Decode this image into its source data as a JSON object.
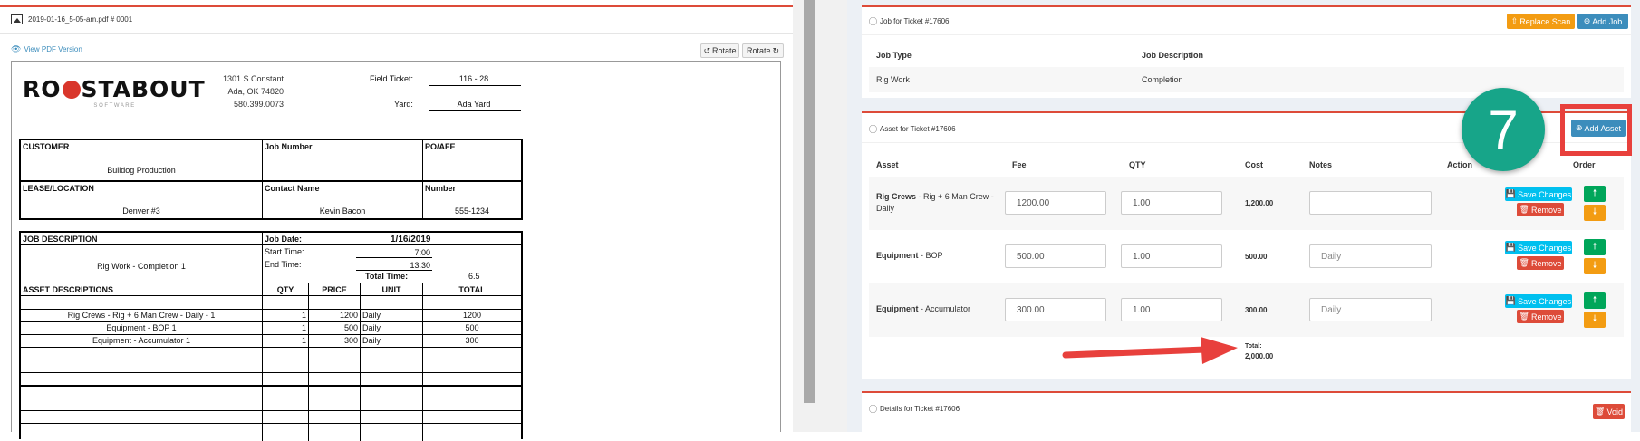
{
  "left_panel": {
    "file_name": "2019-01-16_5-05-am.pdf # 0001",
    "view_pdf_label": "View PDF Version",
    "rotate_left_label": "Rotate",
    "rotate_right_label": "Rotate",
    "document": {
      "logo_text_1": "RO",
      "logo_text_2": "STABOUT",
      "logo_sub": "S O F T W A R E",
      "address": [
        "1301 S Constant",
        "Ada, OK 74820",
        "580.399.0073"
      ],
      "field_ticket_label": "Field Ticket:",
      "field_ticket_value": "116 - 28",
      "yard_label": "Yard:",
      "yard_value": "Ada Yard",
      "customer_label": "CUSTOMER",
      "customer_value": "Bulldog Production",
      "job_number_label": "Job Number",
      "po_label": "PO/AFE",
      "lease_label": "LEASE/LOCATION",
      "lease_value": "Denver #3",
      "contact_label": "Contact Name",
      "contact_value": "Kevin Bacon",
      "number_label": "Number",
      "number_value": "555-1234",
      "job_desc_label": "JOB DESCRIPTION",
      "job_desc_value": "Rig Work - Completion 1",
      "job_date_label": "Job Date:",
      "job_date_value": "1/16/2019",
      "start_time_label": "Start Time:",
      "start_time_value": "7:00",
      "end_time_label": "End Time:",
      "end_time_value": "13:30",
      "total_time_label": "Total Time:",
      "total_time_value": "6.5",
      "asset_headers": [
        "ASSET DESCRIPTIONS",
        "QTY",
        "PRICE",
        "UNIT",
        "TOTAL"
      ],
      "asset_rows": [
        {
          "desc": "Rig Crews - Rig + 6 Man Crew - Daily - 1",
          "qty": "1",
          "price": "1200",
          "unit": "Daily",
          "total": "1200"
        },
        {
          "desc": "Equipment - BOP 1",
          "qty": "1",
          "price": "500",
          "unit": "Daily",
          "total": "500"
        },
        {
          "desc": "Equipment - Accumulator 1",
          "qty": "1",
          "price": "300",
          "unit": "Daily",
          "total": "300"
        }
      ]
    }
  },
  "job_panel": {
    "title": "Job for Ticket #17606",
    "replace_scan_label": "Replace Scan",
    "add_job_label": "Add Job",
    "col_type": "Job Type",
    "col_desc": "Job Description",
    "row_type": "Rig Work",
    "row_desc": "Completion"
  },
  "asset_panel": {
    "title": "Asset for Ticket #17606",
    "add_asset_label": "Add Asset",
    "step_number": "7",
    "headers": {
      "asset": "Asset",
      "fee": "Fee",
      "qty": "QTY",
      "cost": "Cost",
      "notes": "Notes",
      "action": "Action",
      "order": "Order"
    },
    "save_label": "Save Changes",
    "remove_label": "Remove",
    "rows": [
      {
        "name_bold": "Rig Crews",
        "name_rest": " - Rig + 6 Man Crew - Daily",
        "fee": "1200.00",
        "qty": "1.00",
        "cost": "1,200.00",
        "notes": ""
      },
      {
        "name_bold": "Equipment",
        "name_rest": " - BOP",
        "fee": "500.00",
        "qty": "1.00",
        "cost": "500.00",
        "notes": "Daily"
      },
      {
        "name_bold": "Equipment",
        "name_rest": " - Accumulator",
        "fee": "300.00",
        "qty": "1.00",
        "cost": "300.00",
        "notes": "Daily"
      }
    ],
    "total_label": "Total:",
    "total_value": "2,000.00"
  },
  "details_panel": {
    "title": "Details for Ticket #17606",
    "void_label": "Void"
  },
  "colors": {
    "red_rule": "#dd4b39",
    "primary": "#3c8dbc",
    "info": "#00c0ef",
    "danger": "#dd4b39",
    "success": "#00a65a",
    "warning": "#f39c12",
    "step_circle": "#17a589",
    "highlight": "#e8403c"
  }
}
